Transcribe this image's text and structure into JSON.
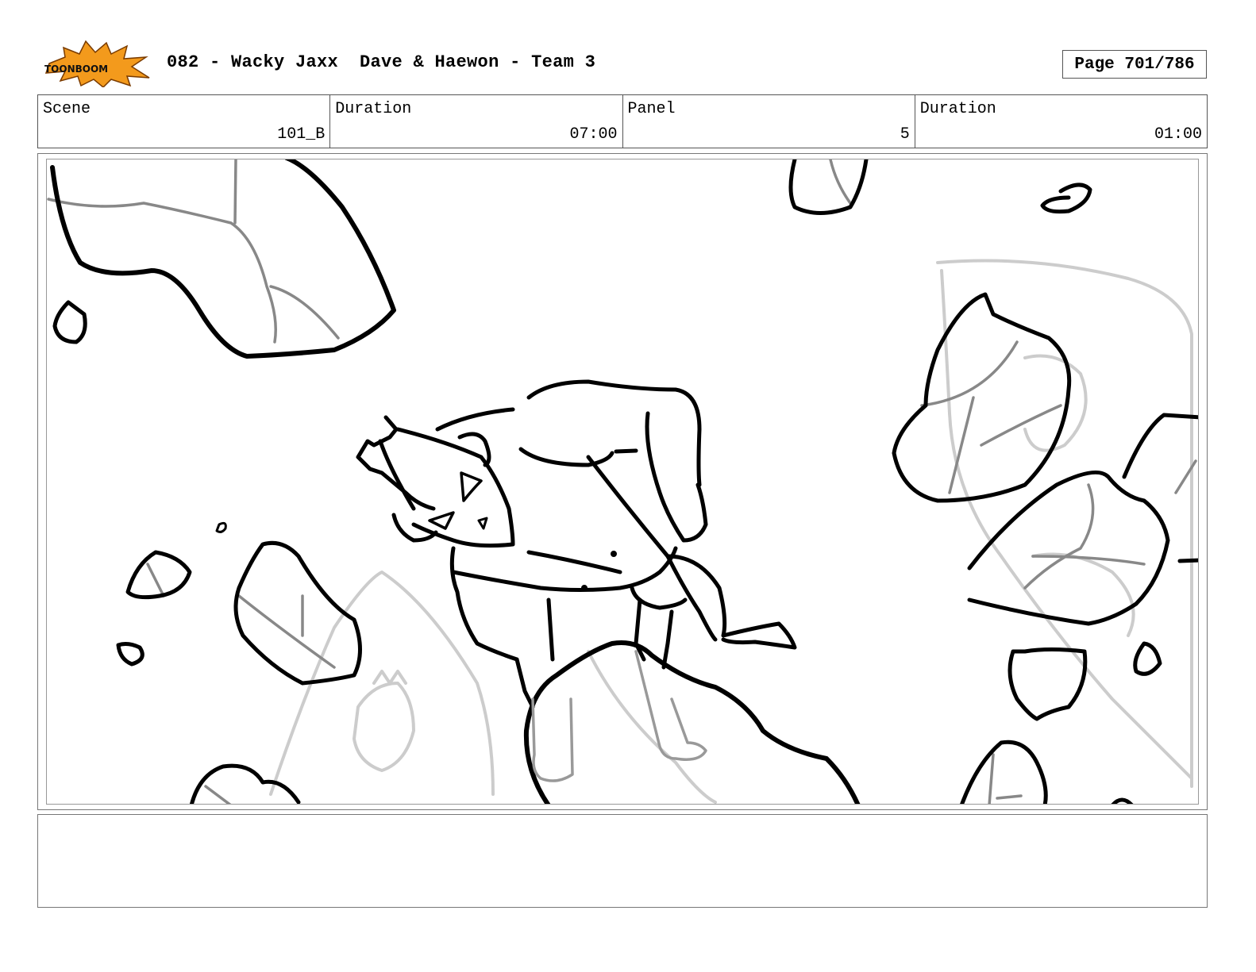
{
  "header": {
    "logo_text": "TOONBOOM",
    "title": "082 - Wacky Jaxx  Dave & Haewon - Team 3",
    "page": "Page 701/786"
  },
  "info": {
    "scene_label": "Scene",
    "scene_value": "101_B",
    "scene_duration_label": "Duration",
    "scene_duration_value": "07:00",
    "panel_label": "Panel",
    "panel_value": "5",
    "panel_duration_label": "Duration",
    "panel_duration_value": "01:00"
  },
  "notes": {
    "text": ""
  },
  "colors": {
    "logo_burst": "#f39a1c",
    "logo_outline": "#222222",
    "ink": "#000000",
    "rough": "#888888",
    "faint": "#cccccc"
  }
}
